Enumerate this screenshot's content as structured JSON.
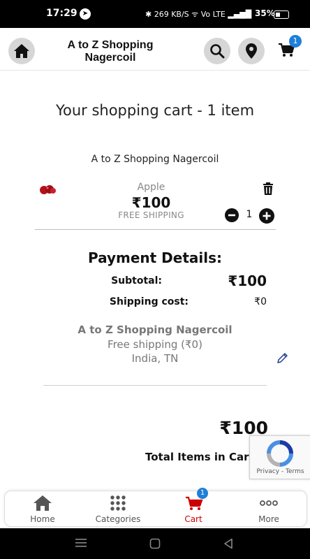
{
  "status_bar": {
    "time": "17:29",
    "system_indicators": "✱ 269 KB/S ᯤ Vo LTE ▂▄▆█",
    "battery": "35%"
  },
  "header": {
    "store_title": "A to Z Shopping Nagercoil",
    "cart_badge": "1"
  },
  "cart": {
    "heading": "Your shopping cart - 1 item",
    "seller": "A to Z Shopping Nagercoil",
    "items": [
      {
        "name": "Apple",
        "price": "₹100",
        "shipping": "FREE SHIPPING",
        "quantity": "1"
      }
    ]
  },
  "payment": {
    "title": "Payment Details:",
    "subtotal_label": "Subtotal:",
    "subtotal_value": "₹100",
    "shipping_label": "Shipping cost:",
    "shipping_value": "₹0"
  },
  "address": {
    "name": "A to Z Shopping Nagercoil",
    "shipping": "Free shipping (₹0)",
    "location": "India, TN"
  },
  "total": {
    "value": "₹100",
    "items_label": "Total Items in Car"
  },
  "recaptcha": {
    "links": "Privacy - Terms"
  },
  "bottom_nav": {
    "items": [
      {
        "label": "Home",
        "icon": "home-icon"
      },
      {
        "label": "Categories",
        "icon": "grid-icon"
      },
      {
        "label": "Cart",
        "icon": "cart-icon",
        "badge": "1"
      },
      {
        "label": "More",
        "icon": "more-icon"
      }
    ]
  },
  "colors": {
    "accent_blue": "#1e7fd8",
    "cart_active": "#cc0000",
    "muted_text": "#777777"
  }
}
